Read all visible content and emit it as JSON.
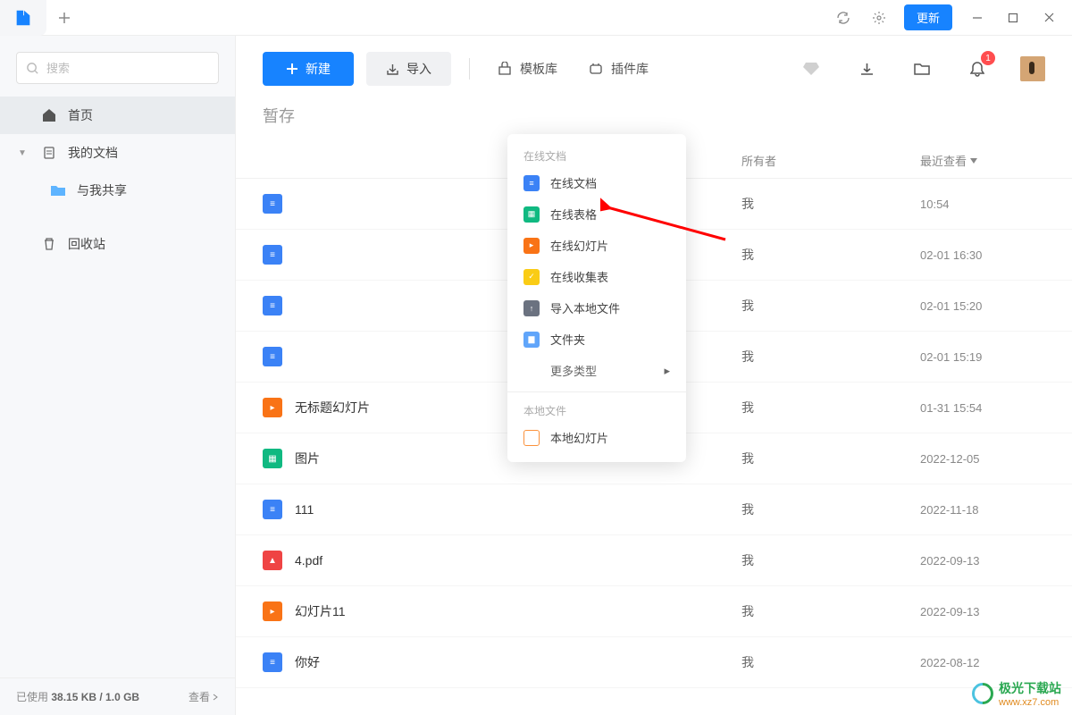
{
  "titlebar": {
    "update_label": "更新"
  },
  "sidebar": {
    "search_placeholder": "搜索",
    "home": "首页",
    "mydocs": "我的文档",
    "shared": "与我共享",
    "trash": "回收站",
    "storage_used_label": "已使用",
    "storage_used": "38.15 KB / 1.0 GB",
    "storage_view": "查看"
  },
  "toolbar": {
    "new_label": "新建",
    "import_label": "导入",
    "templates": "模板库",
    "plugins": "插件库",
    "notif_count": "1"
  },
  "page": {
    "title_partial": "暂存"
  },
  "table": {
    "col_owner": "所有者",
    "col_time": "最近查看"
  },
  "dropdown": {
    "section_online": "在线文档",
    "doc": "在线文档",
    "sheet": "在线表格",
    "slide": "在线幻灯片",
    "form": "在线收集表",
    "import_local": "导入本地文件",
    "folder": "文件夹",
    "more": "更多类型",
    "section_local": "本地文件",
    "local_slide": "本地幻灯片"
  },
  "files": [
    {
      "name": "",
      "owner": "我",
      "time": "10:54",
      "icon": "doc"
    },
    {
      "name": "",
      "owner": "我",
      "time": "02-01 16:30",
      "icon": "doc"
    },
    {
      "name": "",
      "owner": "我",
      "time": "02-01 15:20",
      "icon": "doc"
    },
    {
      "name": "",
      "owner": "我",
      "time": "02-01 15:19",
      "icon": "doc"
    },
    {
      "name": "无标题幻灯片",
      "owner": "我",
      "time": "01-31 15:54",
      "icon": "slide"
    },
    {
      "name": "图片",
      "owner": "我",
      "time": "2022-12-05",
      "icon": "sheet"
    },
    {
      "name": "111",
      "owner": "我",
      "time": "2022-11-18",
      "icon": "doc"
    },
    {
      "name": "4.pdf",
      "owner": "我",
      "time": "2022-09-13",
      "icon": "pdf"
    },
    {
      "name": "幻灯片11",
      "owner": "我",
      "time": "2022-09-13",
      "icon": "slide"
    },
    {
      "name": "你好",
      "owner": "我",
      "time": "2022-08-12",
      "icon": "doc"
    }
  ],
  "watermark": {
    "brand": "极光下载站",
    "url": "www.xz7.com"
  }
}
